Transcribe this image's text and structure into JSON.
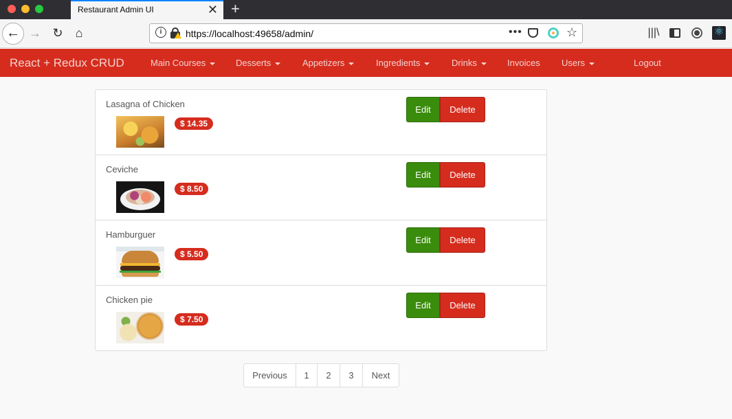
{
  "browser": {
    "tab_title": "Restaurant Admin UI",
    "tab_close": "✕",
    "new_tab": "+",
    "url": "https://localhost:49658/admin/",
    "url_more": "•••"
  },
  "navbar": {
    "brand": "React + Redux CRUD",
    "menu": [
      {
        "label": "Main Courses",
        "dropdown": true
      },
      {
        "label": "Desserts",
        "dropdown": true
      },
      {
        "label": "Appetizers",
        "dropdown": true
      },
      {
        "label": "Ingredients",
        "dropdown": true
      },
      {
        "label": "Drinks",
        "dropdown": true
      },
      {
        "label": "Invoices",
        "dropdown": false
      },
      {
        "label": "Users",
        "dropdown": true
      }
    ],
    "logout": "Logout",
    "color": "#d52c1e"
  },
  "items": [
    {
      "name": "Lasagna of Chicken",
      "price": "$ 14.35",
      "image": "lasagna-image"
    },
    {
      "name": "Ceviche",
      "price": "$ 8.50",
      "image": "ceviche-image"
    },
    {
      "name": "Hamburguer",
      "price": "$ 5.50",
      "image": "hamburger-image"
    },
    {
      "name": "Chicken pie",
      "price": "$ 7.50",
      "image": "chicken-pie-image"
    }
  ],
  "actions": {
    "edit": "Edit",
    "delete": "Delete",
    "edit_color": "#3a8c0c",
    "delete_color": "#d52c1e"
  },
  "pagination": {
    "previous": "Previous",
    "pages": [
      "1",
      "2",
      "3"
    ],
    "next": "Next"
  }
}
